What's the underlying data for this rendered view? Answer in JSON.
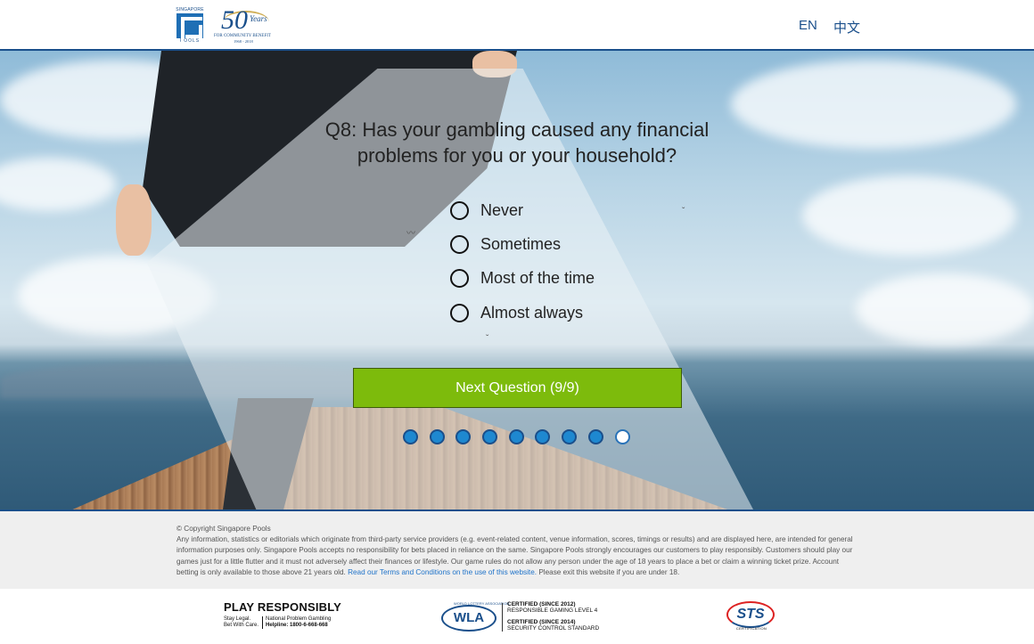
{
  "header": {
    "logo_top": "SINGAPORE",
    "logo_bottom": "POOLS",
    "anniv_number": "50",
    "anniv_years": "Years",
    "anniv_tagline": "FOR COMMUNITY BENEFIT",
    "anniv_dates": "1968 - 2018",
    "lang_en": "EN",
    "lang_zh": "中文"
  },
  "quiz": {
    "question": "Q8: Has your gambling caused any financial problems for you or your household?",
    "options": [
      "Never",
      "Sometimes",
      "Most of the time",
      "Almost always"
    ],
    "next_label": "Next Question (9/9)",
    "progress_total": 9,
    "progress_current": 9
  },
  "footer": {
    "copyright": "© Copyright Singapore Pools",
    "disclaimer": "Any information, statistics or editorials which originate from third-party service providers (e.g. event-related content, venue information, scores, timings or results) and are displayed here, are intended for general information purposes only. Singapore Pools accepts no responsibility for bets placed in reliance on the same. Singapore Pools strongly encourages our customers to play responsibly. Customers should play our games just for a little flutter and it must not adversely affect their finances or lifestyle. Our game rules do not allow any person under the age of 18 years to place a bet or claim a winning ticket prize. Account betting is only available to those above 21 years old.",
    "terms_link": "Read our Terms and Conditions on the use of this website.",
    "exit_note": "Please exit this website if you are under 18."
  },
  "certifications": {
    "play_title": "PLAY RESPONSIBLY",
    "play_l1": "Stay Legal.",
    "play_l2": "Bet With Care.",
    "helpline_l1": "National Problem Gambling",
    "helpline_l2": "Helpline: 1800-6-668-668",
    "wla_mark": "WLA",
    "wla_small": "WORLD LOTTERY ASSOCIATION",
    "wla_c1_title": "CERTIFIED (SINCE 2012)",
    "wla_c1_sub": "RESPONSIBLE GAMING LEVEL 4",
    "wla_c2_title": "CERTIFIED (SINCE 2014)",
    "wla_c2_sub": "SECURITY CONTROL STANDARD",
    "sts_mark": "STS",
    "sts_sub": "CERTIFICATION"
  },
  "colors": {
    "brand_blue": "#1a4f8b",
    "button_green": "#7dbb0c",
    "dot_blue": "#1e88d0"
  }
}
